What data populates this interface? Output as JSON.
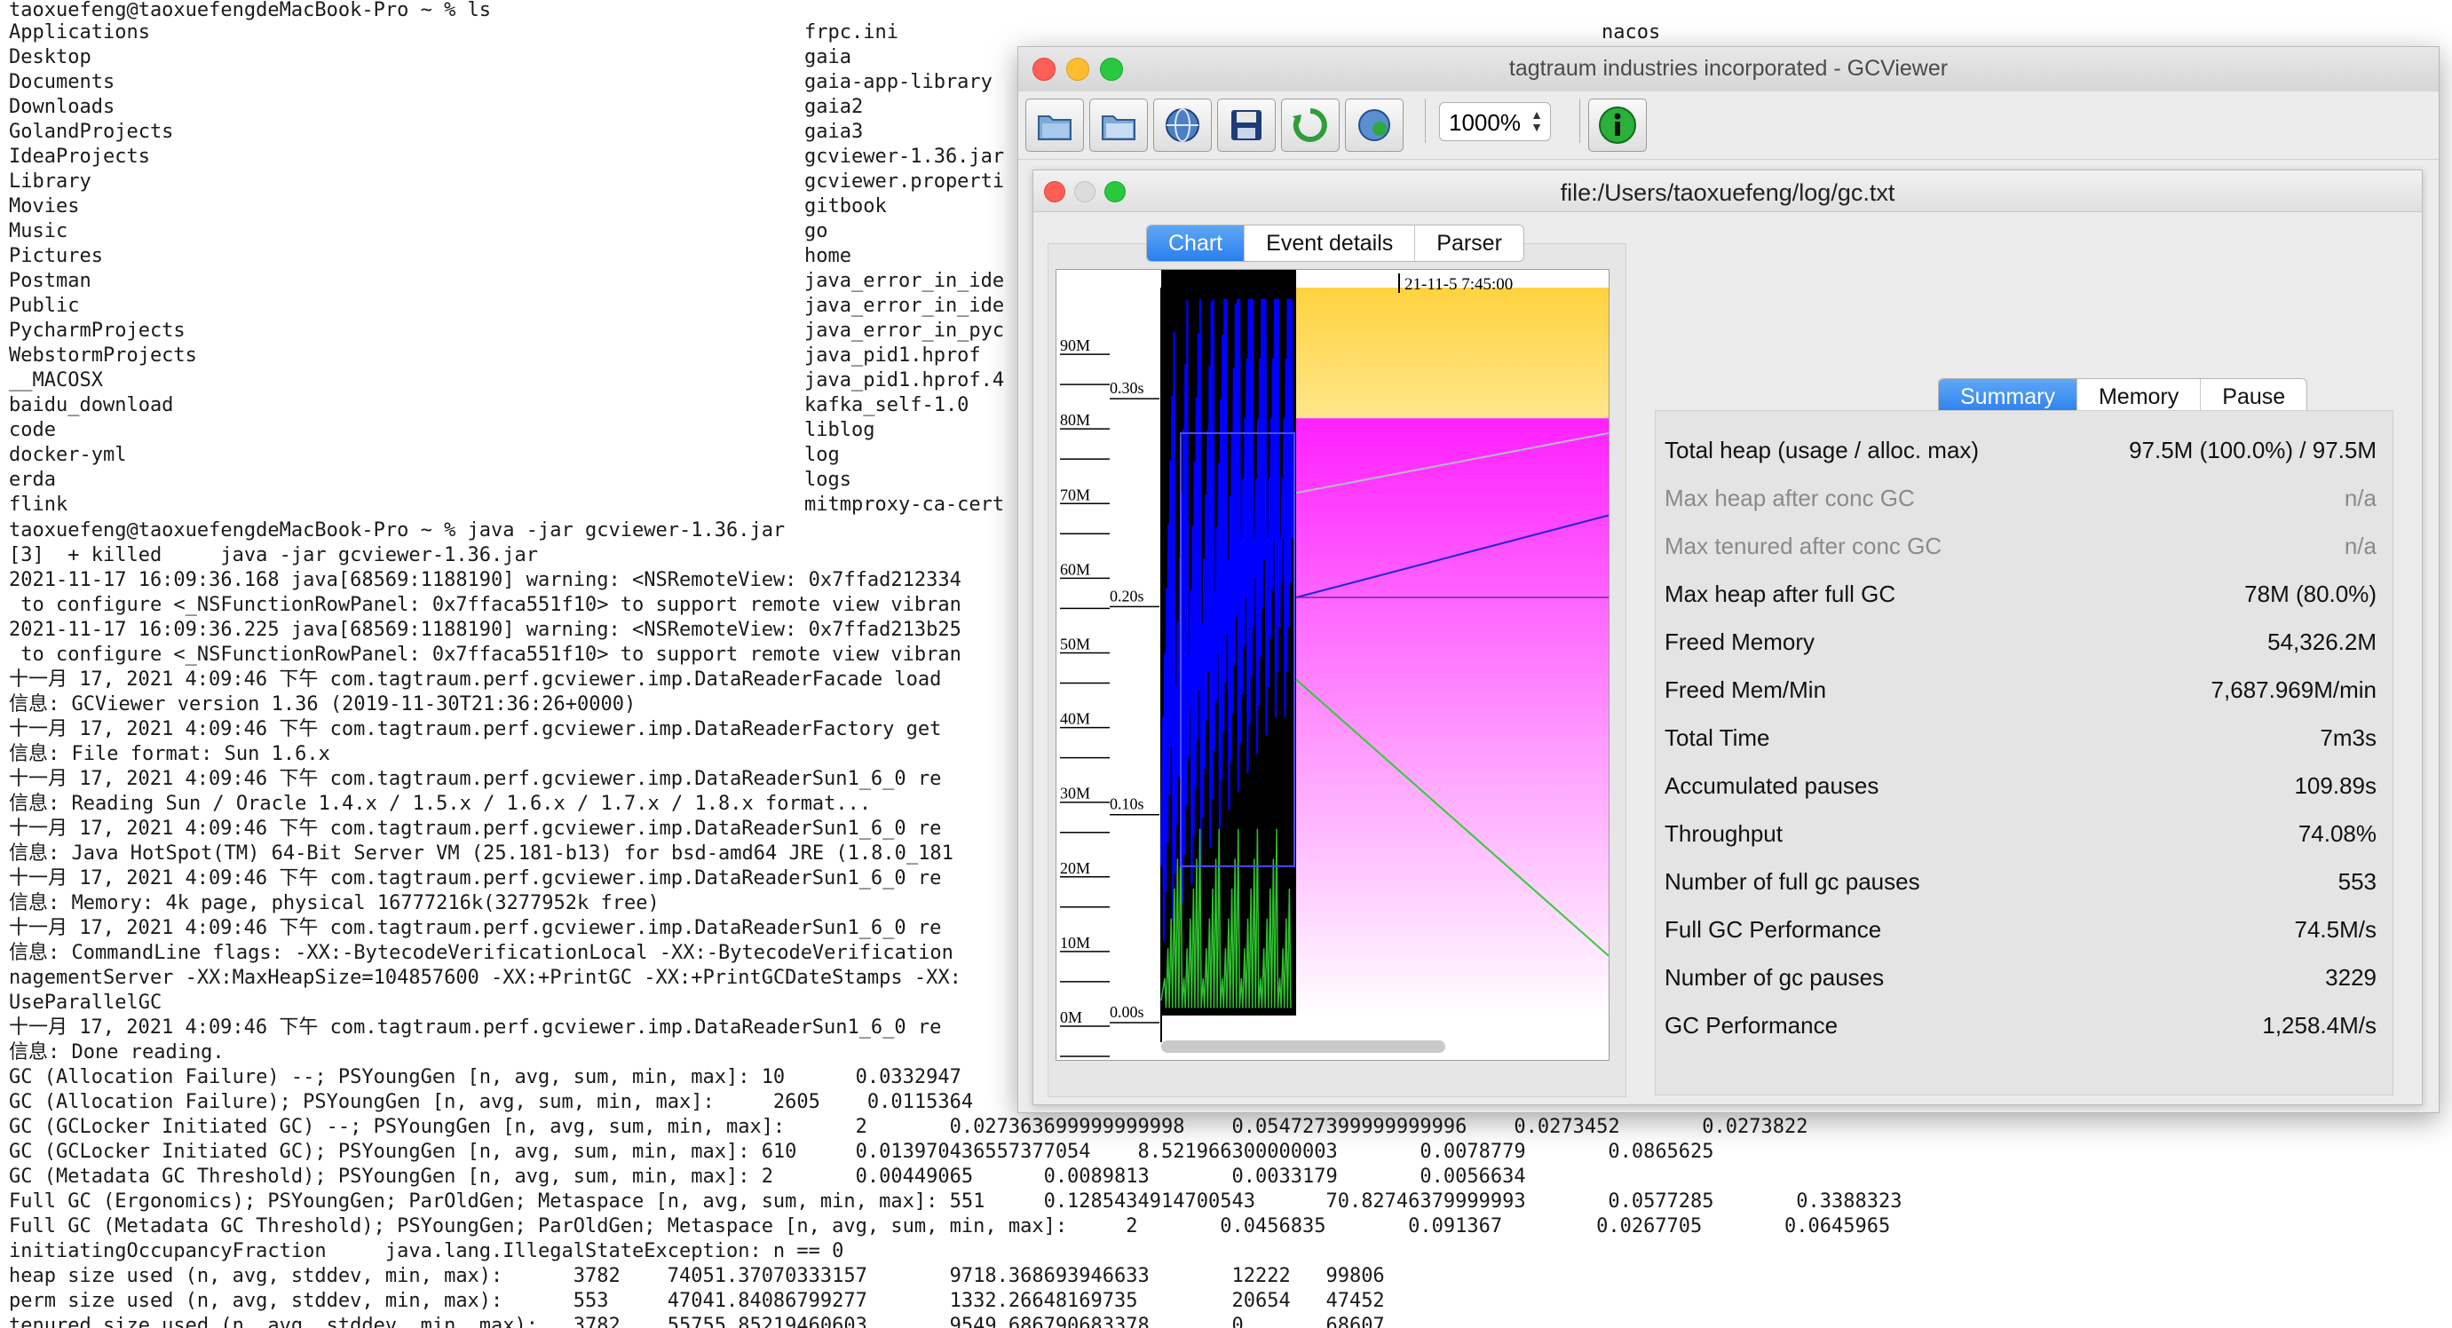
{
  "terminal": {
    "prompt_ls": "taoxuefeng@taoxuefengdeMacBook-Pro ~ % ls",
    "ls_col1": [
      "Applications",
      "Desktop",
      "Documents",
      "Downloads",
      "GolandProjects",
      "IdeaProjects",
      "Library",
      "Movies",
      "Music",
      "Pictures",
      "Postman",
      "Public",
      "PycharmProjects",
      "WebstormProjects",
      "__MACOSX",
      "baidu_download",
      "code",
      "docker-yml",
      "erda",
      "flink"
    ],
    "ls_col2": [
      "frpc.ini",
      "gaia",
      "gaia-app-library",
      "gaia2",
      "gaia3",
      "gcviewer-1.36.jar",
      "gcviewer.properti",
      "gitbook",
      "go",
      "home",
      "java_error_in_ide",
      "java_error_in_ide",
      "java_error_in_pyc",
      "java_pid1.hprof",
      "java_pid1.hprof.4",
      "kafka_self-1.0",
      "liblog",
      "log",
      "logs",
      "mitmproxy-ca-cert"
    ],
    "ls_col3": [
      "nacos"
    ],
    "lines": [
      "taoxuefeng@taoxuefengdeMacBook-Pro ~ % java -jar gcviewer-1.36.jar",
      "[3]  + killed     java -jar gcviewer-1.36.jar",
      "2021-11-17 16:09:36.168 java[68569:1188190] warning: <NSRemoteView: 0x7ffad212334",
      " to configure <_NSFunctionRowPanel: 0x7ffaca551f10> to support remote view vibran",
      "2021-11-17 16:09:36.225 java[68569:1188190] warning: <NSRemoteView: 0x7ffad213b25",
      " to configure <_NSFunctionRowPanel: 0x7ffaca551f10> to support remote view vibran",
      "十一月 17, 2021 4:09:46 下午 com.tagtraum.perf.gcviewer.imp.DataReaderFacade load",
      "信息: GCViewer version 1.36 (2019-11-30T21:36:26+0000)",
      "十一月 17, 2021 4:09:46 下午 com.tagtraum.perf.gcviewer.imp.DataReaderFactory get",
      "信息: File format: Sun 1.6.x",
      "十一月 17, 2021 4:09:46 下午 com.tagtraum.perf.gcviewer.imp.DataReaderSun1_6_0 re",
      "信息: Reading Sun / Oracle 1.4.x / 1.5.x / 1.6.x / 1.7.x / 1.8.x format...",
      "十一月 17, 2021 4:09:46 下午 com.tagtraum.perf.gcviewer.imp.DataReaderSun1_6_0 re",
      "信息: Java HotSpot(TM) 64-Bit Server VM (25.181-b13) for bsd-amd64 JRE (1.8.0_181",
      "十一月 17, 2021 4:09:46 下午 com.tagtraum.perf.gcviewer.imp.DataReaderSun1_6_0 re",
      "信息: Memory: 4k page, physical 16777216k(3277952k free)",
      "十一月 17, 2021 4:09:46 下午 com.tagtraum.perf.gcviewer.imp.DataReaderSun1_6_0 re",
      "信息: CommandLine flags: -XX:-BytecodeVerificationLocal -XX:-BytecodeVerification",
      "nagementServer -XX:MaxHeapSize=104857600 -XX:+PrintGC -XX:+PrintGCDateStamps -XX:",
      "UseParallelGC",
      "十一月 17, 2021 4:09:46 下午 com.tagtraum.perf.gcviewer.imp.DataReaderSun1_6_0 re",
      "信息: Done reading.",
      "GC (Allocation Failure) --; PSYoungGen [n, avg, sum, min, max]: 10      0.0332947",
      "GC (Allocation Failure); PSYoungGen [n, avg, sum, min, max]:     2605    0.0115364",
      "GC (GCLocker Initiated GC) --; PSYoungGen [n, avg, sum, min, max]:      2       0.027363699999999998    0.054727399999999996    0.0273452       0.0273822",
      "GC (GCLocker Initiated GC); PSYoungGen [n, avg, sum, min, max]: 610     0.013970436557377054    8.521966300000003       0.0078779       0.0865625",
      "GC (Metadata GC Threshold); PSYoungGen [n, avg, sum, min, max]: 2       0.00449065      0.0089813       0.0033179       0.0056634",
      "Full GC (Ergonomics); PSYoungGen; ParOldGen; Metaspace [n, avg, sum, min, max]: 551     0.1285434914700543      70.82746379999993       0.0577285       0.3388323",
      "Full GC (Metadata GC Threshold); PSYoungGen; ParOldGen; Metaspace [n, avg, sum, min, max]:     2       0.0456835       0.091367        0.0267705       0.0645965",
      "initiatingOccupancyFraction     java.lang.IllegalStateException: n == 0",
      "heap size used (n, avg, stddev, min, max):      3782    74051.37070333157       9718.368693946633       12222   99806",
      "perm size used (n, avg, stddev, min, max):      553     47041.84086799277       1332.26648169735        20654   47452",
      "tenured size used (n, avg, stddev, min, max):   3782    55755.85219460603       9549.686790683378       0       68607"
    ]
  },
  "window": {
    "title": "tagtraum industries incorporated - GCViewer",
    "zoom": "1000%",
    "toolbar_icons": [
      "open-file-icon",
      "open-url-icon",
      "web-icon",
      "save-icon",
      "refresh-icon",
      "watch-icon",
      "info-icon"
    ]
  },
  "document": {
    "title": "file:/Users/taoxuefeng/log/gc.txt",
    "chart_tabs": [
      "Chart",
      "Event details",
      "Parser"
    ],
    "selected_chart_tab": "Chart",
    "timestamp": "21-11-5 7:45:00",
    "mem_ticks": [
      "90M",
      "80M",
      "70M",
      "60M",
      "50M",
      "40M",
      "30M",
      "20M",
      "10M",
      "0M"
    ],
    "pause_ticks": [
      "0.30s",
      "0.20s",
      "0.10s",
      "0.00s"
    ],
    "summary_tabs": [
      "Summary",
      "Memory",
      "Pause"
    ],
    "selected_summary_tab": "Summary",
    "summary": [
      {
        "label": "Total heap (usage / alloc. max)",
        "value": "97.5M (100.0%) / 97.5M",
        "dim": false
      },
      {
        "label": "Max heap after conc GC",
        "value": "n/a",
        "dim": true
      },
      {
        "label": "Max tenured after conc GC",
        "value": "n/a",
        "dim": true
      },
      {
        "label": "Max heap after full GC",
        "value": "78M (80.0%)",
        "dim": false
      },
      {
        "label": "Freed Memory",
        "value": "54,326.2M",
        "dim": false
      },
      {
        "label": "Freed Mem/Min",
        "value": "7,687.969M/min",
        "dim": false
      },
      {
        "label": "Total Time",
        "value": "7m3s",
        "dim": false
      },
      {
        "label": "Accumulated pauses",
        "value": "109.89s",
        "dim": false
      },
      {
        "label": "Throughput",
        "value": "74.08%",
        "dim": false
      },
      {
        "label": "Number of full gc pauses",
        "value": "553",
        "dim": false
      },
      {
        "label": "Full GC Performance",
        "value": "74.5M/s",
        "dim": false
      },
      {
        "label": "Number of gc pauses",
        "value": "3229",
        "dim": false
      },
      {
        "label": "GC Performance",
        "value": "1,258.4M/s",
        "dim": false
      }
    ]
  },
  "colors": {
    "tenured_fill": "#ffd23f",
    "young_fill": "#ff20ff",
    "used_heap": "#0000ff",
    "full_gc": "#000000",
    "tab_selected": "#2a7ef0"
  }
}
